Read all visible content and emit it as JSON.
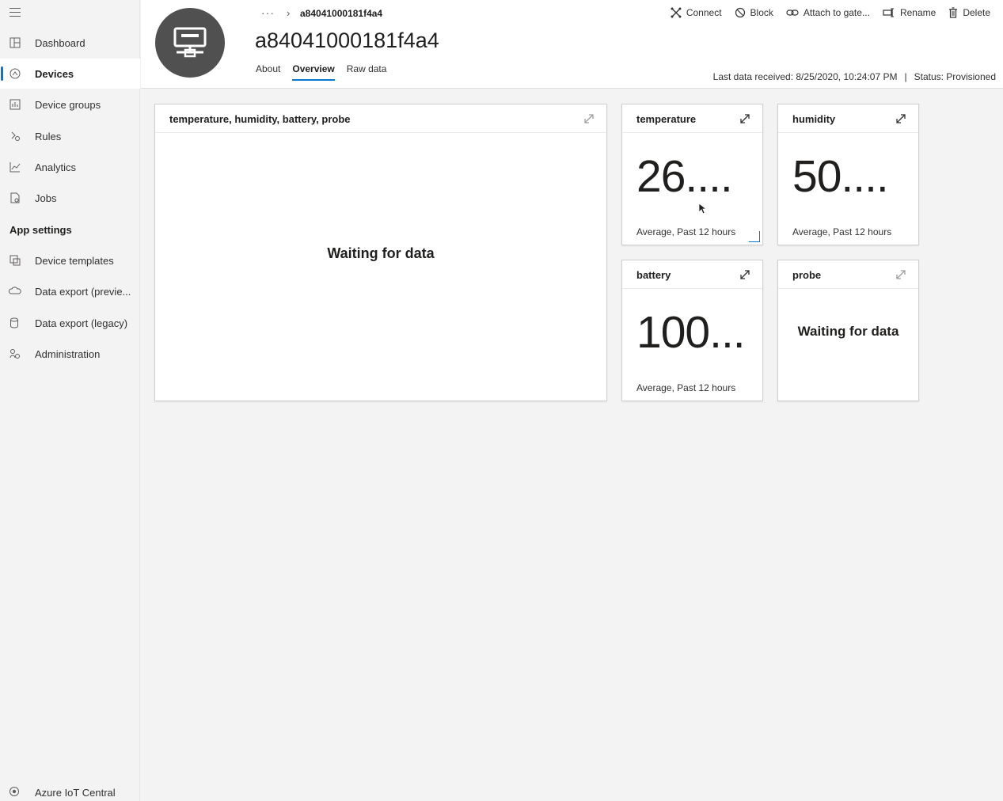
{
  "sidebar": {
    "items": [
      {
        "label": "Dashboard",
        "icon": "dashboard-icon"
      },
      {
        "label": "Devices",
        "icon": "devices-icon",
        "active": true
      },
      {
        "label": "Device groups",
        "icon": "device-groups-icon"
      },
      {
        "label": "Rules",
        "icon": "rules-icon"
      },
      {
        "label": "Analytics",
        "icon": "analytics-icon"
      },
      {
        "label": "Jobs",
        "icon": "jobs-icon"
      }
    ],
    "section_title": "App settings",
    "settings_items": [
      {
        "label": "Device templates",
        "icon": "device-templates-icon"
      },
      {
        "label": "Data export (previe...",
        "icon": "data-export-preview-icon"
      },
      {
        "label": "Data export (legacy)",
        "icon": "data-export-legacy-icon"
      },
      {
        "label": "Administration",
        "icon": "administration-icon"
      }
    ],
    "footer_label": "Azure IoT Central"
  },
  "header": {
    "breadcrumb_dots": "···",
    "breadcrumb_current": "a84041000181f4a4",
    "device_name": "a84041000181f4a4",
    "tabs": [
      {
        "label": "About"
      },
      {
        "label": "Overview",
        "active": true
      },
      {
        "label": "Raw data"
      }
    ],
    "commands": [
      {
        "label": "Connect",
        "icon": "connect-icon"
      },
      {
        "label": "Block",
        "icon": "block-icon"
      },
      {
        "label": "Attach to gate...",
        "icon": "attach-icon"
      },
      {
        "label": "Rename",
        "icon": "rename-icon"
      },
      {
        "label": "Delete",
        "icon": "delete-icon"
      }
    ],
    "last_data": "Last data received: 8/25/2020, 10:24:07 PM",
    "separator": "|",
    "status": "Status: Provisioned"
  },
  "tiles": {
    "chart": {
      "title": "temperature, humidity, battery, probe",
      "message": "Waiting for data"
    },
    "temperature": {
      "title": "temperature",
      "value": "26....",
      "caption": "Average, Past 12 hours"
    },
    "humidity": {
      "title": "humidity",
      "value": "50....",
      "caption": "Average, Past 12 hours"
    },
    "battery": {
      "title": "battery",
      "value": "100...",
      "caption": "Average, Past 12 hours"
    },
    "probe": {
      "title": "probe",
      "message": "Waiting for data"
    }
  },
  "colors": {
    "accent": "#0078d4",
    "avatar": "#505050"
  }
}
